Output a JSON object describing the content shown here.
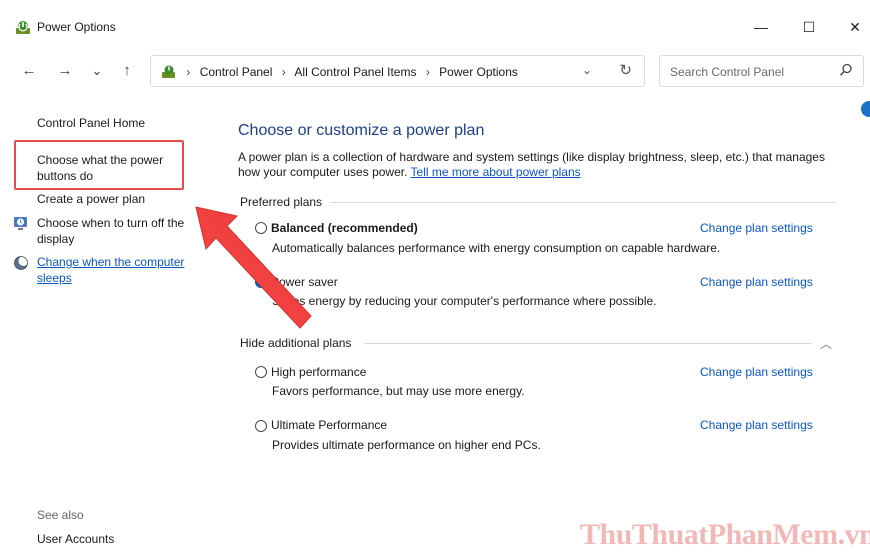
{
  "window": {
    "title": "Power Options",
    "minimize_glyph": "—",
    "maximize_glyph": "☐",
    "close_glyph": "✕"
  },
  "nav": {
    "back_glyph": "←",
    "forward_glyph": "→",
    "recent_glyph": "⌄",
    "up_glyph": "↑"
  },
  "address": {
    "breadcrumbs": [
      "Control Panel",
      "All Control Panel Items",
      "Power Options"
    ],
    "separator": "›",
    "dropdown_glyph": "⌄",
    "refresh_glyph": "↻"
  },
  "search": {
    "placeholder": "Search Control Panel"
  },
  "sidebar": {
    "home": "Control Panel Home",
    "power_buttons": "Choose what the power buttons do",
    "create_plan": "Create a power plan",
    "turn_off_display": "Choose when to turn off the display",
    "change_sleep": "Change when the computer sleeps"
  },
  "main": {
    "title": "Choose or customize a power plan",
    "intro_text": "A power plan is a collection of hardware and system settings (like display brightness, sleep, etc.) that manages how your computer uses power.",
    "intro_link": "Tell me more about power plans",
    "preferred_heading": "Preferred plans",
    "additional_heading": "Hide additional plans",
    "collapse_glyph": "︿",
    "plans": [
      {
        "name": "Balanced (recommended)",
        "description": "Automatically balances performance with energy consumption on capable hardware.",
        "link": "Change plan settings",
        "selected": false
      },
      {
        "name": "Power saver",
        "description": "Saves energy by reducing your computer's performance where possible.",
        "link": "Change plan settings",
        "selected": true
      },
      {
        "name": "High performance",
        "description": "Favors performance, but may use more energy.",
        "link": "Change plan settings",
        "selected": false
      },
      {
        "name": "Ultimate Performance",
        "description": "Provides ultimate performance on higher end PCs.",
        "link": "Change plan settings",
        "selected": false
      }
    ]
  },
  "see_also": {
    "label": "See also",
    "user_accounts": "User Accounts"
  },
  "watermark": "ThuThuatPhanMem.vn",
  "colors": {
    "accent": "#005fb8",
    "link": "#0b55c4",
    "title": "#1e3e8a",
    "highlight": "#e84a4a"
  }
}
